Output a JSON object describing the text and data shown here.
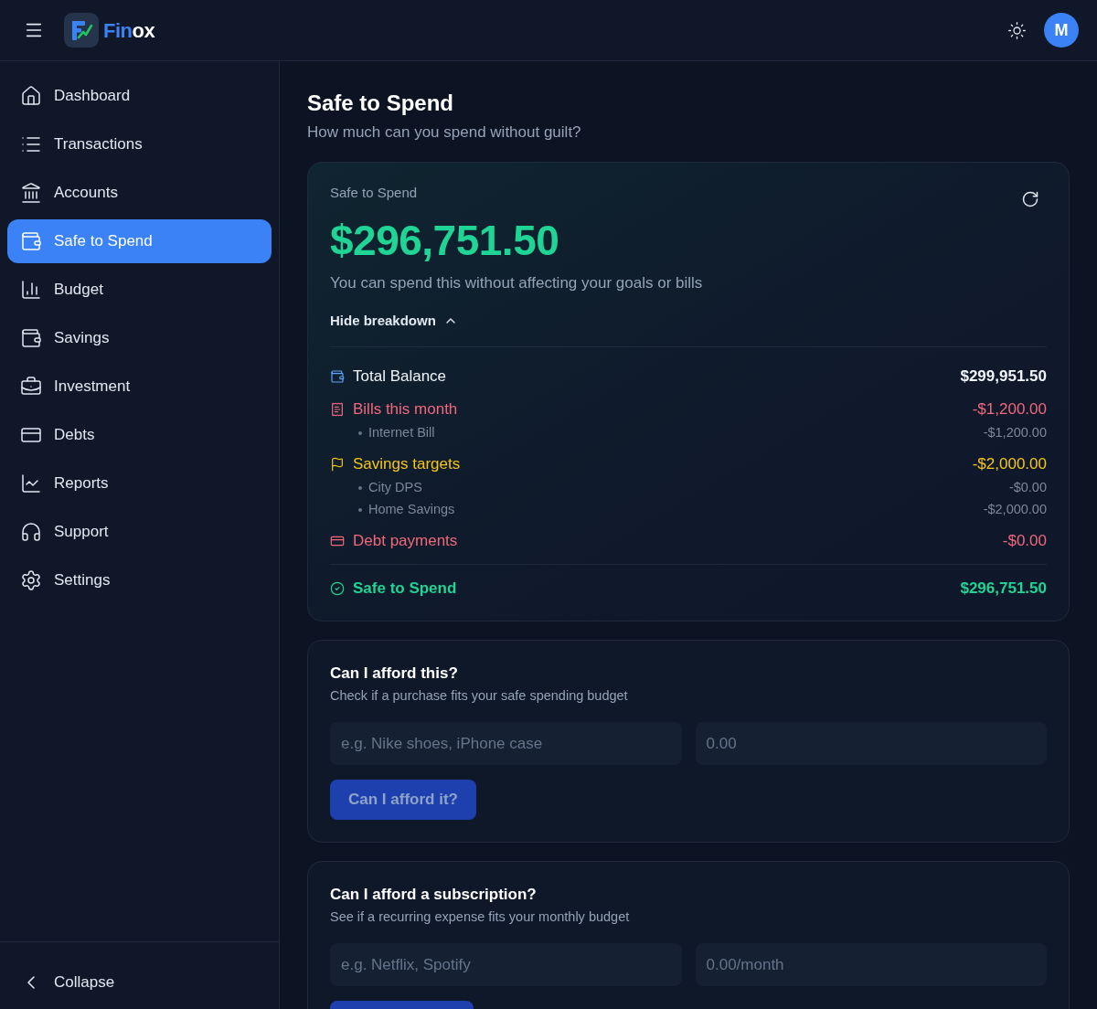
{
  "header": {
    "logo": {
      "parts": [
        "Fin",
        "ox"
      ]
    },
    "avatar": "M"
  },
  "sidebar": {
    "items": [
      {
        "label": "Dashboard",
        "selected": false
      },
      {
        "label": "Transactions",
        "selected": false
      },
      {
        "label": "Accounts",
        "selected": false
      },
      {
        "label": "Safe to Spend",
        "selected": true
      },
      {
        "label": "Budget",
        "selected": false
      },
      {
        "label": "Savings",
        "selected": false
      },
      {
        "label": "Investment",
        "selected": false
      },
      {
        "label": "Debts",
        "selected": false
      },
      {
        "label": "Reports",
        "selected": false
      },
      {
        "label": "Support",
        "selected": false
      },
      {
        "label": "Settings",
        "selected": false
      }
    ],
    "collapse": "Collapse"
  },
  "page": {
    "title": "Safe to Spend",
    "subtitle": "How much can you spend without guilt?"
  },
  "summary": {
    "label": "Safe to Spend",
    "amount": "$296,751.50",
    "description": "You can spend this without affecting your goals or bills",
    "toggle": "Hide breakdown",
    "expanded": true,
    "breakdown": [
      {
        "kind": "balance",
        "label": "Total Balance",
        "value": "$299,951.50",
        "color": "#f1f5f9"
      },
      {
        "kind": "bills",
        "label": "Bills this month",
        "value": "-$1,200.00",
        "color": "#f1687c",
        "items": [
          {
            "label": "Internet Bill",
            "value": "-$1,200.00"
          }
        ]
      },
      {
        "kind": "savings",
        "label": "Savings targets",
        "value": "-$2,000.00",
        "color": "#f5c518",
        "items": [
          {
            "label": "City DPS",
            "value": "-$0.00"
          },
          {
            "label": "Home Savings",
            "value": "-$2,000.00"
          }
        ]
      },
      {
        "kind": "debt",
        "label": "Debt payments",
        "value": "-$0.00",
        "color": "#f1687c"
      }
    ],
    "result": {
      "label": "Safe to Spend",
      "value": "$296,751.50"
    }
  },
  "purchase_check": {
    "title": "Can I afford this?",
    "subtitle": "Check if a purchase fits your safe spending budget",
    "fields": [
      {
        "placeholder": "e.g. Nike shoes, iPhone case"
      },
      {
        "placeholder": "0.00"
      }
    ],
    "button": {
      "label": "Can I afford it?",
      "disabled": true
    }
  },
  "subscription_check": {
    "title": "Can I afford a subscription?",
    "subtitle": "See if a recurring expense fits your monthly budget",
    "fields": [
      {
        "placeholder": "e.g. Netflix, Spotify"
      },
      {
        "placeholder": "0.00/month"
      }
    ],
    "button": {
      "disabled": true
    }
  }
}
